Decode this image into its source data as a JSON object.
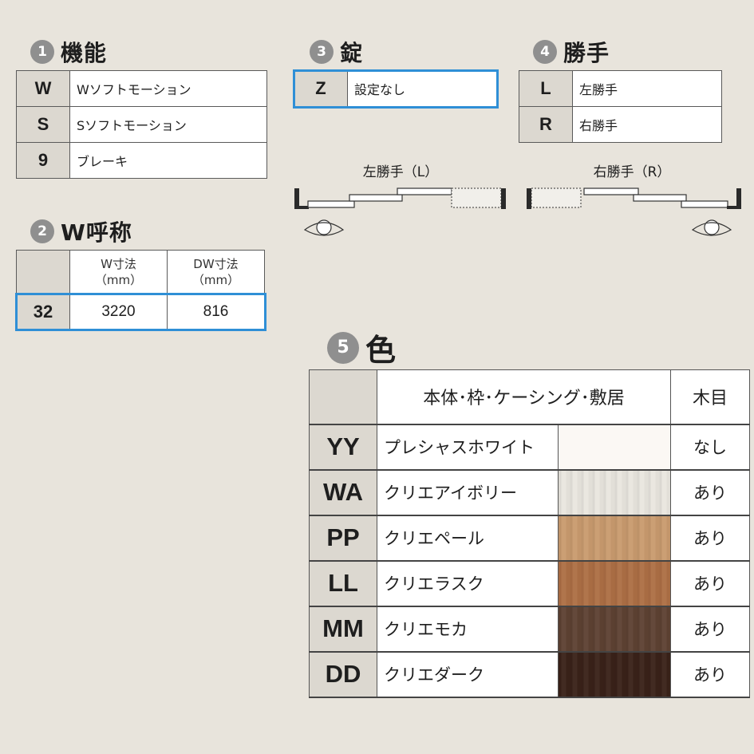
{
  "function_section": {
    "num": "1",
    "title": "機能",
    "rows": [
      {
        "code": "W",
        "desc": "Wソフトモーション"
      },
      {
        "code": "S",
        "desc": "Sソフトモーション"
      },
      {
        "code": "9",
        "desc": "ブレーキ"
      }
    ]
  },
  "wcall_section": {
    "num": "2",
    "title": "W呼称",
    "head_w": "W寸法",
    "head_dw": "DW寸法",
    "unit": "（mm）",
    "row": {
      "code": "32",
      "w": "3220",
      "dw": "816"
    }
  },
  "lock_section": {
    "num": "3",
    "title": "錠",
    "row": {
      "code": "Z",
      "desc": "設定なし"
    }
  },
  "hand_section": {
    "num": "4",
    "title": "勝手",
    "rows": [
      {
        "code": "L",
        "desc": "左勝手"
      },
      {
        "code": "R",
        "desc": "右勝手"
      }
    ],
    "left_label": "左勝手（L）",
    "right_label": "右勝手（R）"
  },
  "color_section": {
    "num": "5",
    "title": "色",
    "head_parts": "本体･枠･ケーシング･敷居",
    "head_grain": "木目",
    "rows": [
      {
        "code": "YY",
        "name": "プレシャスホワイト",
        "swatch": "#fbf8f4",
        "grain": "なし"
      },
      {
        "code": "WA",
        "name": "クリエアイボリー",
        "swatch": "#e9e6df",
        "grain": "あり"
      },
      {
        "code": "PP",
        "name": "クリエペール",
        "swatch": "#c99b6e",
        "grain": "あり"
      },
      {
        "code": "LL",
        "name": "クリエラスク",
        "swatch": "#ad6f45",
        "grain": "あり"
      },
      {
        "code": "MM",
        "name": "クリエモカ",
        "swatch": "#5e4233",
        "grain": "あり"
      },
      {
        "code": "DD",
        "name": "クリエダーク",
        "swatch": "#3a2219",
        "grain": "あり"
      }
    ]
  },
  "colors": {
    "highlight": "#2f8fd6",
    "code_bg": "#dcd8d0",
    "page_bg": "#e8e4dc"
  }
}
